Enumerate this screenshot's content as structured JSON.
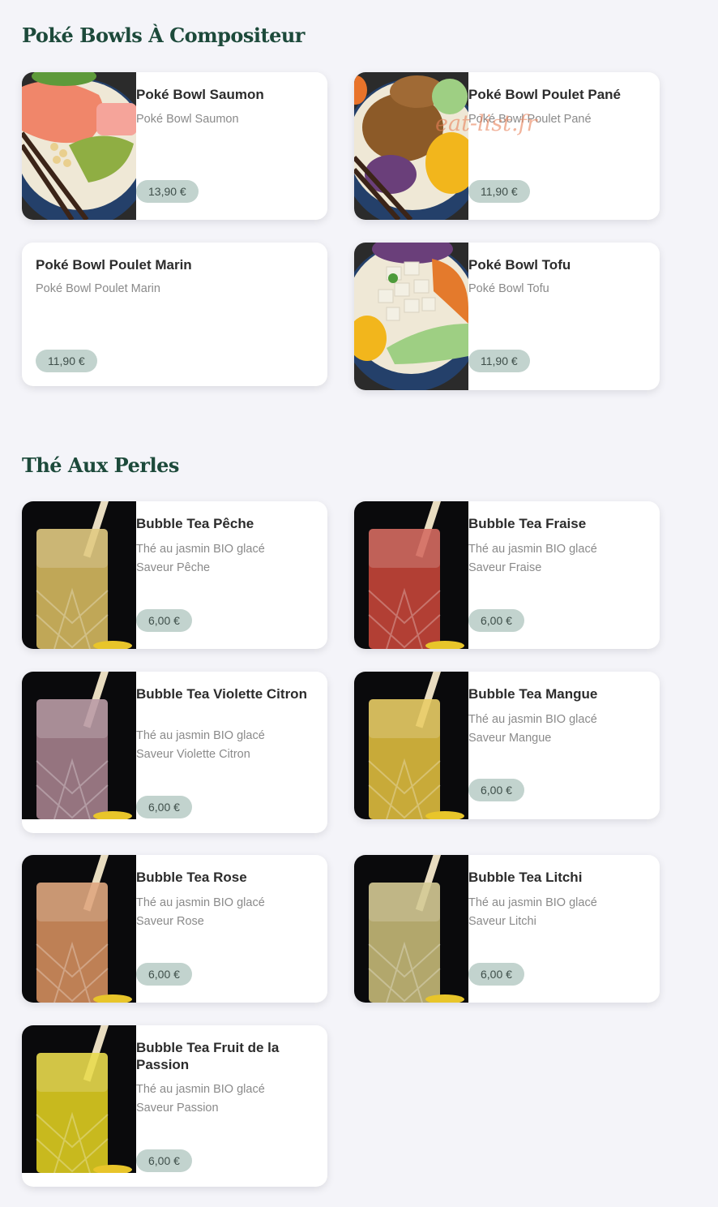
{
  "watermark": "eat-list.fr",
  "sections": [
    {
      "title": "Poké Bowls À Compositeur",
      "items": [
        {
          "name": "Poké Bowl Saumon",
          "desc1": "Poké Bowl Saumon",
          "price": "13,90 €",
          "image": "salmon-poke-bowl"
        },
        {
          "name": "Poké Bowl Poulet Pané",
          "desc1": "Poké Bowl Poulet Pané",
          "price": "11,90 €",
          "image": "breaded-chicken-poke-bowl"
        },
        {
          "name": "Poké Bowl Poulet Marin",
          "desc1": "Poké Bowl Poulet Marin",
          "price": "11,90 €"
        },
        {
          "name": "Poké Bowl Tofu",
          "desc1": "Poké Bowl Tofu",
          "price": "11,90 €",
          "image": "tofu-poke-bowl"
        }
      ]
    },
    {
      "title": "Thé Aux Perles",
      "items": [
        {
          "name": "Bubble Tea Pêche",
          "desc1": "Thé au jasmin BIO glacé",
          "desc2": "Saveur Pêche",
          "price": "6,00 €",
          "image": "peach-bubble-tea",
          "color": "#d9bd62"
        },
        {
          "name": "Bubble Tea Fraise",
          "desc1": "Thé au jasmin BIO glacé",
          "desc2": "Saveur Fraise",
          "price": "6,00 €",
          "image": "strawberry-bubble-tea",
          "color": "#c9473a"
        },
        {
          "name": "Bubble Tea Violette Citron",
          "desc1": "Thé au jasmin BIO glacé",
          "desc2": "Saveur Violette Citron",
          "price": "6,00 €",
          "image": "violet-lemon-bubble-tea",
          "color": "#a8838f"
        },
        {
          "name": "Bubble Tea Mangue",
          "desc1": "Thé au jasmin BIO glacé",
          "desc2": "Saveur Mangue",
          "price": "6,00 €",
          "image": "mango-bubble-tea",
          "color": "#e2c040"
        },
        {
          "name": "Bubble Tea Rose",
          "desc1": "Thé au jasmin BIO glacé",
          "desc2": "Saveur Rose",
          "price": "6,00 €",
          "image": "rose-bubble-tea",
          "color": "#d79160"
        },
        {
          "name": "Bubble Tea Litchi",
          "desc1": "Thé au jasmin BIO glacé",
          "desc2": "Saveur Litchi",
          "price": "6,00 €",
          "image": "lychee-bubble-tea",
          "color": "#c9bd7a"
        },
        {
          "name": "Bubble Tea Fruit de la Passion",
          "desc1": "Thé au jasmin BIO glacé",
          "desc2": "Saveur Passion",
          "price": "6,00 €",
          "image": "passion-fruit-bubble-tea",
          "color": "#e2d221"
        }
      ]
    }
  ]
}
